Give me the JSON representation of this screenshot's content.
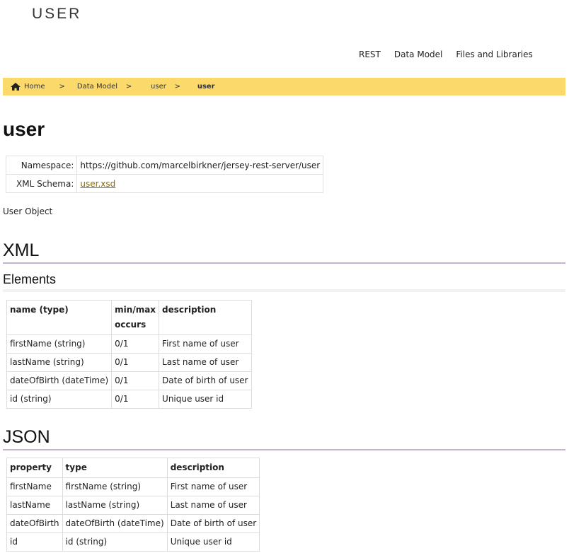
{
  "header": {
    "site_title": "USER"
  },
  "nav": {
    "items": [
      "REST",
      "Data Model",
      "Files and Libraries"
    ]
  },
  "breadcrumb": {
    "home": "Home",
    "sep": ">",
    "data_model": "Data Model",
    "user": "user",
    "current": "user"
  },
  "page": {
    "title": "user",
    "namespace_label": "Namespace:",
    "namespace_value": "https://github.com/marcelbirkner/jersey-rest-server/user",
    "schema_label": "XML Schema:",
    "schema_link": "user.xsd",
    "description": "User Object"
  },
  "xml": {
    "heading": "XML",
    "elements_heading": "Elements",
    "columns": [
      "name (type)",
      "min/max occurs",
      "description"
    ],
    "rows": [
      [
        "firstName (string)",
        "0/1",
        "First name of user"
      ],
      [
        "lastName (string)",
        "0/1",
        "Last name of user"
      ],
      [
        "dateOfBirth (dateTime)",
        "0/1",
        "Date of birth of user"
      ],
      [
        "id (string)",
        "0/1",
        "Unique user id"
      ]
    ]
  },
  "json": {
    "heading": "JSON",
    "columns": [
      "property",
      "type",
      "description"
    ],
    "rows": [
      [
        "firstName",
        "firstName (string)",
        "First name of user"
      ],
      [
        "lastName",
        "lastName (string)",
        "Last name of user"
      ],
      [
        "dateOfBirth",
        "dateOfBirth (dateTime)",
        "Date of birth of user"
      ],
      [
        "id",
        "id (string)",
        "Unique user id"
      ]
    ]
  },
  "colors": {
    "breadcrumb_bg": "#fcd96b",
    "heading_rule": "#c4b2d3",
    "link": "#8a6d00"
  },
  "icons": {
    "home": "home-icon"
  }
}
